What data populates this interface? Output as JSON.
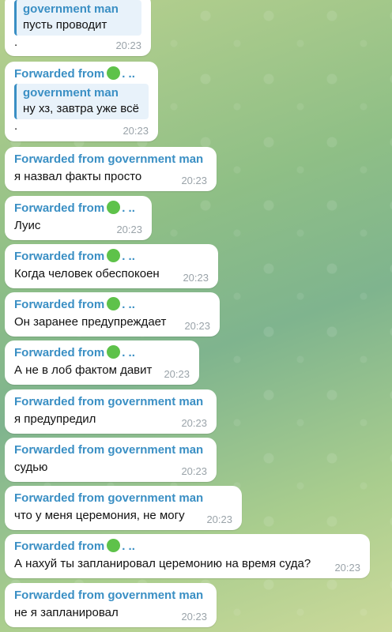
{
  "messages": [
    {
      "kind": "reply_top",
      "quote_name": "government man",
      "quote_text": "пусть проводит",
      "dot": ".",
      "time": "20:23"
    },
    {
      "kind": "reply",
      "forwarded": "Forwarded from",
      "dots": ". ..",
      "quote_name": "government man",
      "quote_text": "ну хз, завтра уже всё",
      "dot": ".",
      "time": "20:23"
    },
    {
      "forwarded": "Forwarded from government man",
      "text": "я назвал факты просто",
      "time": "20:23"
    },
    {
      "forwarded": "Forwarded from",
      "dots": ". ..",
      "text": "Луис",
      "time": "20:23"
    },
    {
      "forwarded": "Forwarded from",
      "dots": ". ..",
      "text": "Когда человек обеспокоен",
      "time": "20:23"
    },
    {
      "forwarded": "Forwarded from",
      "dots": ". ..",
      "text": "Он заранее предупреждает",
      "time": "20:23"
    },
    {
      "forwarded": "Forwarded from",
      "dots": ". ..",
      "text": "А не в лоб фактом давит",
      "time": "20:23"
    },
    {
      "forwarded": "Forwarded from government man",
      "text": "я предупредил",
      "time": "20:23"
    },
    {
      "forwarded": "Forwarded from government man",
      "text": "судью",
      "time": "20:23"
    },
    {
      "forwarded": "Forwarded from government man",
      "text": "что у меня церемония, не могу",
      "time": "20:23"
    },
    {
      "forwarded": "Forwarded from",
      "dots": ". ..",
      "text": "А нахуй ты запланировал церемонию на время суда?",
      "time": "20:23"
    },
    {
      "forwarded": "Forwarded from government man",
      "text": "не я запланировал",
      "time": "20:23"
    }
  ],
  "colors": {
    "link": "#3a8fc4",
    "avatar_dot": "#5ec24a",
    "bubble": "#ffffff",
    "time": "#9aa3a9"
  },
  "icons": {
    "avatar_dot": "green-circle-emoji-icon"
  }
}
